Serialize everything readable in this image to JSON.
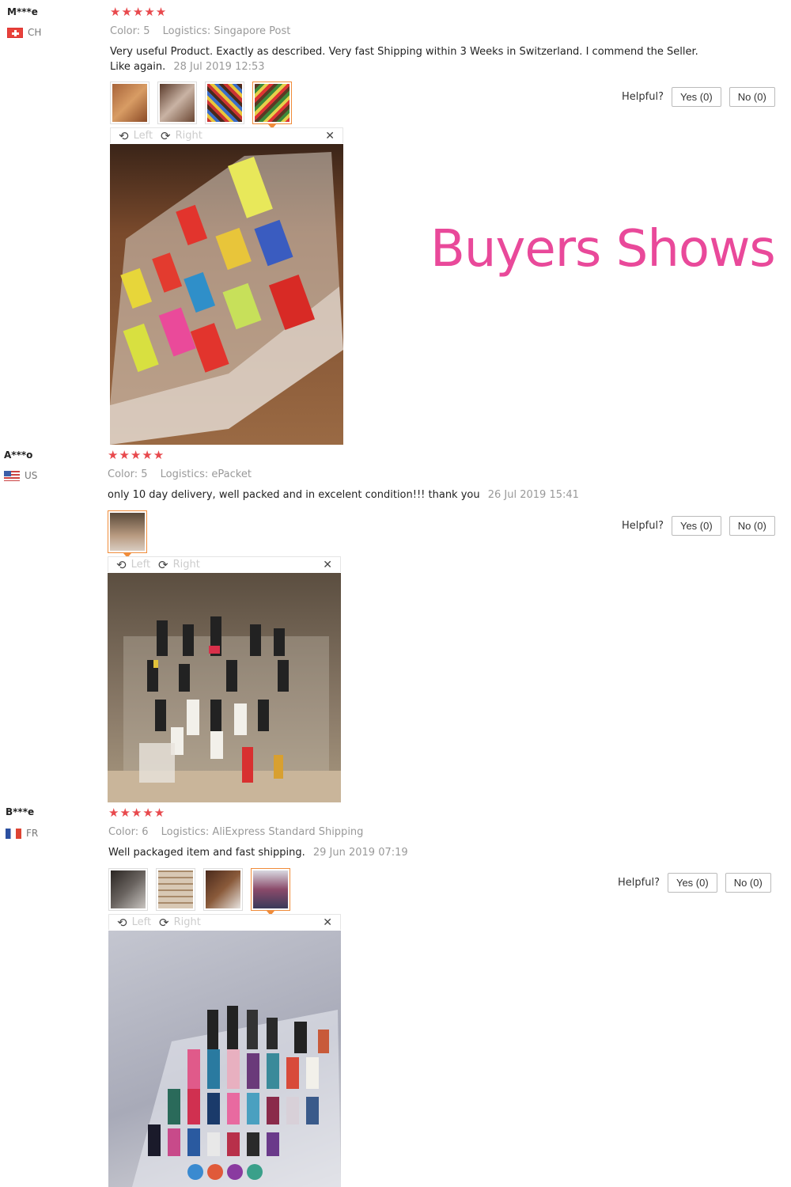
{
  "banner": "Buyers Shows",
  "labels": {
    "color": "Color:",
    "logistics": "Logistics:",
    "helpful": "Helpful?",
    "left": "Left",
    "right": "Right"
  },
  "reviews": [
    {
      "user": "M***e",
      "country": "CH",
      "stars": "★★★★★",
      "color": "5",
      "logistics": "Singapore Post",
      "text": "Very useful Product. Exactly as described. Very fast Shipping within 3 Weeks in Switzerland. I commend the Seller. Like again.",
      "date": "28 Jul 2019 12:53",
      "yes": "Yes (0)",
      "no": "No (0)"
    },
    {
      "user": "A***o",
      "country": "US",
      "stars": "★★★★★",
      "color": "5",
      "logistics": "ePacket",
      "text": "only 10 day delivery, well packed and in excelent condition!!! thank you",
      "date": "26 Jul 2019 15:41",
      "yes": "Yes (0)",
      "no": "No (0)"
    },
    {
      "user": "B***e",
      "country": "FR",
      "stars": "★★★★★",
      "color": "6",
      "logistics": "AliExpress Standard Shipping",
      "text": "Well packaged item and fast shipping.",
      "date": "29 Jun 2019 07:19",
      "yes": "Yes (0)",
      "no": "No (0)"
    }
  ]
}
